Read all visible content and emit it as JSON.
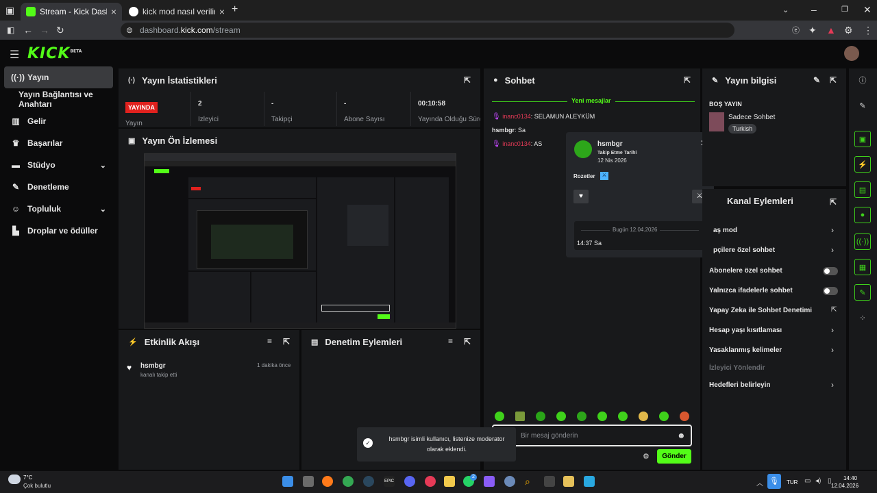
{
  "browser": {
    "tabs": [
      {
        "title": "Stream - Kick Dashboard",
        "active": true
      },
      {
        "title": "kick mod nasıl verilir - Google'da",
        "active": false
      }
    ],
    "url_prefix": "dashboard.",
    "url_host": "kick.com",
    "url_path": "/stream",
    "new_tab": "+"
  },
  "kick": {
    "logo": "KICK",
    "logo_sup": "BETA"
  },
  "sidebar": {
    "items": [
      {
        "label": "Yayın",
        "icon": "broadcast-icon"
      },
      {
        "label": "Yayın Bağlantısı ve Anahtarı"
      },
      {
        "label": "Gelir",
        "icon": "chart-icon"
      },
      {
        "label": "Başarılar",
        "icon": "trophy-icon"
      },
      {
        "label": "Stüdyo",
        "icon": "studio-icon"
      },
      {
        "label": "Denetleme",
        "icon": "wrench-icon"
      },
      {
        "label": "Topluluk",
        "icon": "community-icon"
      },
      {
        "label": "Droplar ve ödüller",
        "icon": "drops-icon"
      }
    ]
  },
  "stats_panel": {
    "title": "Yayın İstatistikleri",
    "live_badge": "YAYINDA",
    "live_label": "Yayın",
    "stats": [
      {
        "value": "2",
        "label": "İzleyici"
      },
      {
        "value": "-",
        "label": "Takipçi"
      },
      {
        "value": "-",
        "label": "Abone Sayısı"
      },
      {
        "value": "00:10:58",
        "label": "Yayında Olduğu Süre"
      }
    ]
  },
  "preview_panel": {
    "title": "Yayın Ön İzlemesi"
  },
  "activity_panel": {
    "title": "Etkinlik Akışı",
    "events": [
      {
        "user": "hsmbgr",
        "text": "kanalı takip etti",
        "time": "1 dakika önce"
      }
    ]
  },
  "moderation_panel": {
    "title": "Denetim Eylemleri"
  },
  "chat_panel": {
    "title": "Sohbet",
    "new_messages": "Yeni mesajlar",
    "messages": [
      {
        "user": "inanc0134",
        "text": ": SELAMUN ALEYKÜM"
      },
      {
        "user": "hsmbgr",
        "text": ": Sa"
      },
      {
        "user": "inanc0134",
        "text": ": AS"
      }
    ],
    "input_placeholder": "Bir mesaj gönderin",
    "send_label": "Gönder"
  },
  "user_card": {
    "username": "hsmbgr",
    "follow_label": "Takip Etme Tarihi",
    "follow_date": "12 Nis 2026",
    "badges_label": "Rozetler",
    "date_divider": "Bugün 12.04.2026",
    "message_time": "14:37 Sa"
  },
  "info_panel": {
    "title": "Yayın bilgisi",
    "stream_title": "BOŞ YAYIN",
    "category": "Sadece Sohbet",
    "tag": "Turkish"
  },
  "channel_actions": {
    "title": "Kanal Eylemleri",
    "rows": [
      {
        "label": "aş mod",
        "kind": "chevron"
      },
      {
        "label": "pçilere özel sohbet",
        "kind": "chevron"
      },
      {
        "label": "Abonelere özel sohbet",
        "kind": "toggle"
      },
      {
        "label": "Yalnızca ifadelerle sohbet",
        "kind": "toggle"
      },
      {
        "label": "Yapay Zeka ile Sohbet Denetimi",
        "kind": "external"
      },
      {
        "label": "Hesap yaşı kısıtlaması",
        "kind": "chevron"
      },
      {
        "label": "Yasaklanmış kelimeler",
        "kind": "chevron"
      },
      {
        "label": "İzleyici Yönlendir",
        "kind": "header"
      },
      {
        "label": "Hedefleri belirleyin",
        "kind": "chevron"
      }
    ]
  },
  "toast": {
    "text": "hsmbgr isimli kullanıcı, listenize moderator olarak eklendi."
  },
  "taskbar": {
    "weather_temp": "7°C",
    "weather_desc": "Çok bulutlu",
    "lang": "TUR",
    "time": "14:40",
    "date": "12.04.2026",
    "whatsapp_badge": "2"
  },
  "colors": {
    "accent": "#53fc18",
    "live": "#e0211e",
    "panel": "#18191b"
  }
}
